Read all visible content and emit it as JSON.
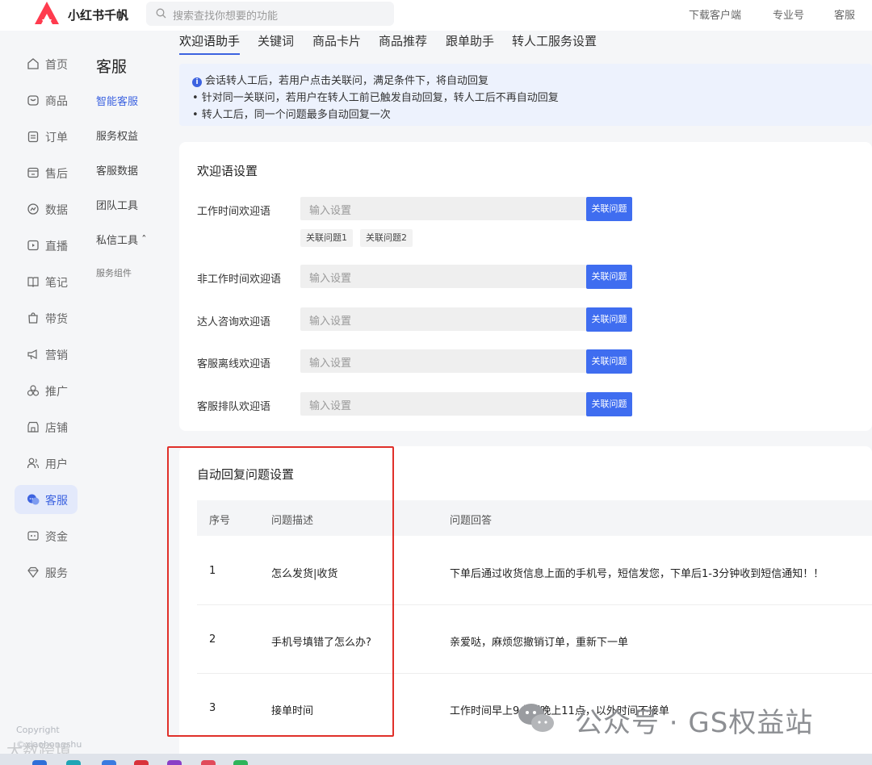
{
  "app": {
    "name": "小红书千帆"
  },
  "search": {
    "placeholder": "搜索查找你想要的功能"
  },
  "topbar": {
    "links": [
      "下载客户端",
      "专业号",
      "客服"
    ]
  },
  "left_nav": {
    "items": [
      "首页",
      "商品",
      "订单",
      "售后",
      "数据",
      "直播",
      "笔记",
      "带货",
      "营销",
      "推广",
      "店铺",
      "用户",
      "客服",
      "资金",
      "服务"
    ],
    "active": "客服",
    "copyright_lines": [
      "Copyright",
      "©xiaohongshu"
    ]
  },
  "sub_nav": {
    "title": "客服",
    "items": [
      "智能客服",
      "服务权益",
      "客服数据",
      "团队工具",
      "私信工具 ˆ",
      "服务组件"
    ],
    "active": "智能客服"
  },
  "tabs": [
    "欢迎语助手",
    "关键词",
    "商品卡片",
    "商品推荐",
    "跟单助手",
    "转人工服务设置"
  ],
  "notice": {
    "lines": [
      "会话转人工后，若用户点击关联问，满足条件下，将自动回复",
      "• 针对同一关联问，若用户在转人工前已触发自动回复，转人工后不再自动回复",
      "• 转人工后，同一个问题最多自动回复一次"
    ]
  },
  "welcome": {
    "title": "欢迎语设置",
    "input_placeholder": "输入设置",
    "button_label": "关联问题",
    "rows": [
      "工作时间欢迎语",
      "非工作时间欢迎语",
      "达人咨询欢迎语",
      "客服离线欢迎语",
      "客服排队欢迎语"
    ],
    "chips": [
      "关联问题1",
      "关联问题2"
    ]
  },
  "auto_reply": {
    "title": "自动回复问题设置",
    "columns": [
      "序号",
      "问题描述",
      "问题回答"
    ],
    "rows": [
      {
        "no": "1",
        "question": "怎么发货|收货",
        "answer": "下单后通过收货信息上面的手机号，短信发您，下单后1-3分钟收到短信通知！！"
      },
      {
        "no": "2",
        "question": "手机号填错了怎么办?",
        "answer": "亲爱哒，麻烦您撤销订单，重新下一单"
      },
      {
        "no": "3",
        "question": "接单时间",
        "answer": "工作时间早上9点到晚上11点，以外时间不接单"
      }
    ]
  },
  "watermarks": {
    "wechat": "公众号 · GS权益站",
    "bottom": "大数跨境"
  },
  "colors": {
    "accent": "#3d63e0",
    "button": "#3f6df0",
    "highlight_box": "#e0302a",
    "notice_bg": "#edf2fd"
  }
}
